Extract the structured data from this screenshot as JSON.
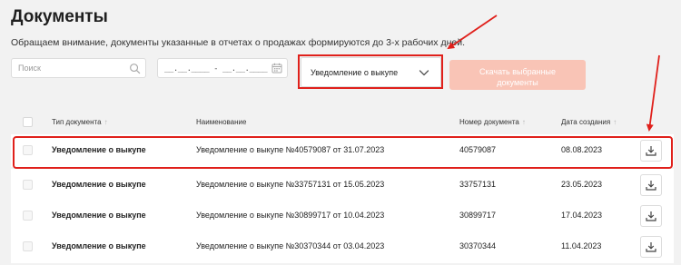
{
  "header": {
    "title": "Документы",
    "notice": "Обращаем внимание, документы указанные в отчетах о продажах формируются до 3-х рабочих дней."
  },
  "filters": {
    "search_placeholder": "Поиск",
    "date_mask": "__.__.____ - __.__.____",
    "doc_type_selected": "Уведомление о выкупе",
    "download_selected_line1": "Скачать выбранные",
    "download_selected_line2": "документы"
  },
  "table": {
    "columns": {
      "type": "Тип документа",
      "name": "Наименование",
      "number": "Номер документа",
      "date": "Дата создания"
    },
    "rows": [
      {
        "type": "Уведомление о выкупе",
        "name": "Уведомление о выкупе №40579087 от 31.07.2023",
        "number": "40579087",
        "date": "08.08.2023"
      },
      {
        "type": "Уведомление о выкупе",
        "name": "Уведомление о выкупе №33757131 от 15.05.2023",
        "number": "33757131",
        "date": "23.05.2023"
      },
      {
        "type": "Уведомление о выкупе",
        "name": "Уведомление о выкупе №30899717 от 10.04.2023",
        "number": "30899717",
        "date": "17.04.2023"
      },
      {
        "type": "Уведомление о выкупе",
        "name": "Уведомление о выкупе №30370344 от 03.04.2023",
        "number": "30370344",
        "date": "11.04.2023"
      }
    ]
  },
  "colors": {
    "accent_disabled": "#f9c4b6",
    "annotation": "#e0201b",
    "background": "#f2f2f2"
  },
  "icons": {
    "search": "search-icon",
    "calendar": "calendar-icon",
    "dropdown": "chevron-down-icon",
    "sort": "sort-arrow-icon",
    "download": "download-icon"
  }
}
